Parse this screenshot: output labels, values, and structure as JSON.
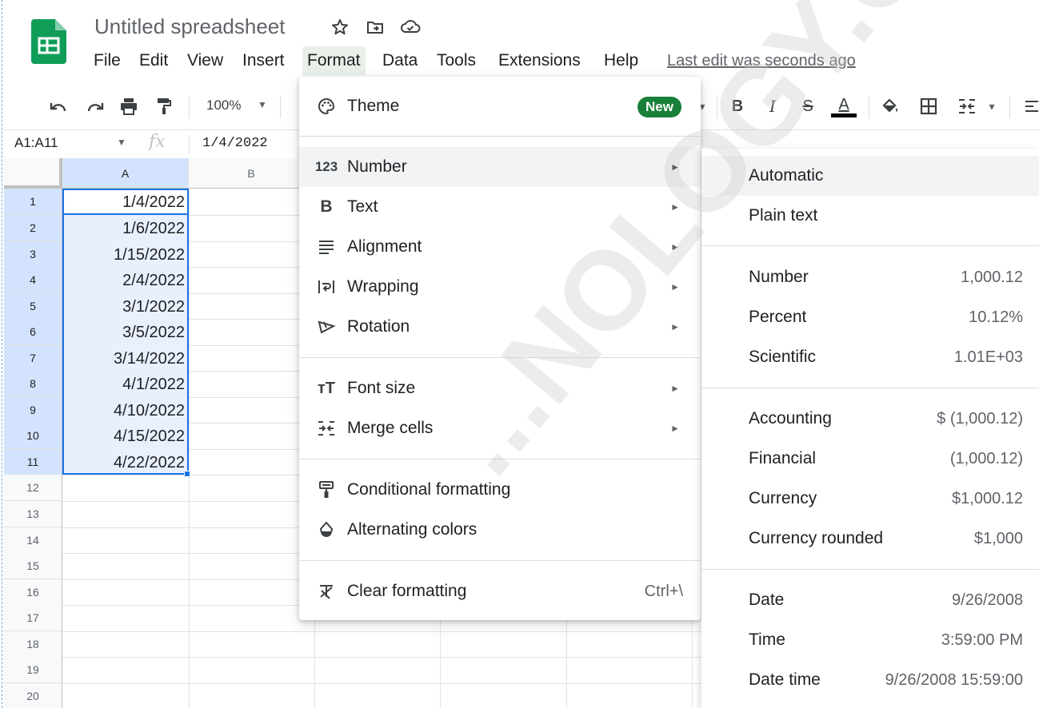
{
  "app": {
    "name": "Google Sheets",
    "logo_icon": "sheets-logo-icon",
    "brand_color": "#0f9d58"
  },
  "document": {
    "title": "Untitled spreadsheet"
  },
  "title_icons": [
    "star-icon",
    "move-to-folder-icon",
    "cloud-status-icon"
  ],
  "menubar": {
    "items": [
      "File",
      "Edit",
      "View",
      "Insert",
      "Format",
      "Data",
      "Tools",
      "Extensions",
      "Help"
    ],
    "active": "Format",
    "last_edit": "Last edit was seconds ago"
  },
  "toolbar": {
    "zoom": "100%",
    "left_icons": [
      "undo-icon",
      "redo-icon",
      "print-icon",
      "paint-format-icon"
    ],
    "right_icons": [
      "bold-icon",
      "italic-icon",
      "strikethrough-icon",
      "text-color-icon",
      "fill-color-icon",
      "borders-icon",
      "merge-cells-icon"
    ],
    "bold": "B",
    "italic": "I",
    "strike": "S",
    "text_color": "A"
  },
  "formula_bar": {
    "name_box": "A1:A11",
    "fx": "fx",
    "value": "1/4/2022"
  },
  "grid": {
    "columns": [
      "A",
      "B"
    ],
    "rows": [
      "1",
      "2",
      "3",
      "4",
      "5",
      "6",
      "7",
      "8",
      "9",
      "10",
      "11",
      "12",
      "13",
      "14",
      "15",
      "16",
      "17",
      "18",
      "19",
      "20"
    ],
    "column_a_values": [
      "1/4/2022",
      "1/6/2022",
      "1/15/2022",
      "2/4/2022",
      "3/1/2022",
      "3/5/2022",
      "3/14/2022",
      "4/1/2022",
      "4/10/2022",
      "4/15/2022",
      "4/22/2022"
    ],
    "selection_color": "#1a73e8"
  },
  "format_menu": {
    "theme": {
      "label": "Theme",
      "badge": "New",
      "icon": "palette-icon"
    },
    "number": {
      "label": "Number",
      "icon": "123-icon",
      "icon_text": "123"
    },
    "text": {
      "label": "Text",
      "icon": "bold-b-icon",
      "icon_text": "B"
    },
    "alignment": {
      "label": "Alignment",
      "icon": "align-icon"
    },
    "wrapping": {
      "label": "Wrapping",
      "icon": "wrap-icon"
    },
    "rotation": {
      "label": "Rotation",
      "icon": "rotate-icon"
    },
    "font_size": {
      "label": "Font size",
      "icon": "font-size-icon",
      "icon_text": "тT"
    },
    "merge_cells": {
      "label": "Merge cells",
      "icon": "merge-icon"
    },
    "conditional_formatting": {
      "label": "Conditional formatting",
      "icon": "paint-roller-icon"
    },
    "alternating_colors": {
      "label": "Alternating colors",
      "icon": "drop-icon"
    },
    "clear_formatting": {
      "label": "Clear formatting",
      "icon": "clear-format-icon",
      "shortcut": "Ctrl+\\"
    },
    "submenu_arrow": "►"
  },
  "number_submenu": {
    "automatic": {
      "label": "Automatic"
    },
    "plain_text": {
      "label": "Plain text"
    },
    "number": {
      "label": "Number",
      "example": "1,000.12"
    },
    "percent": {
      "label": "Percent",
      "example": "10.12%"
    },
    "scientific": {
      "label": "Scientific",
      "example": "1.01E+03"
    },
    "accounting": {
      "label": "Accounting",
      "example": "$ (1,000.12)"
    },
    "financial": {
      "label": "Financial",
      "example": "(1,000.12)"
    },
    "currency": {
      "label": "Currency",
      "example": "$1,000.12"
    },
    "currency_rounded": {
      "label": "Currency rounded",
      "example": "$1,000"
    },
    "date": {
      "label": "Date",
      "example": "9/26/2008"
    },
    "time": {
      "label": "Time",
      "example": "3:59:00 PM"
    },
    "date_time": {
      "label": "Date time",
      "example": "9/26/2008 15:59:00"
    }
  },
  "watermark": "...NOLOGY.COM"
}
